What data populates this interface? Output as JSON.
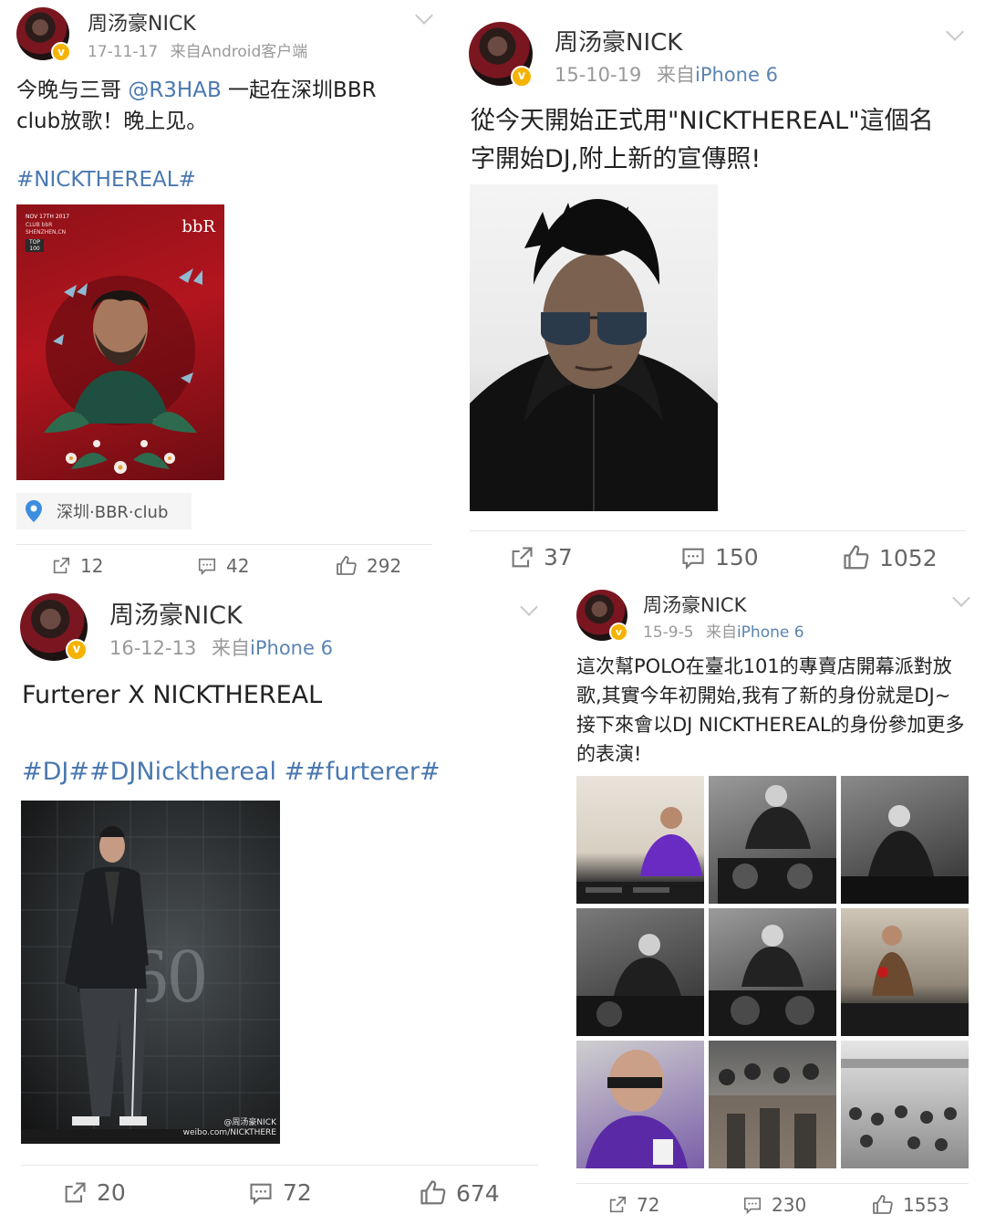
{
  "posts": [
    {
      "user": "周汤豪NICK",
      "date": "17-11-17",
      "source_prefix": "来自",
      "source": "Android客户端",
      "text_before": "今晚与三哥 ",
      "mention": "@R3HAB",
      "text_after": " 一起在深圳BBR club放歌！晚上见。",
      "hashtags": "#NICKTHEREAL#",
      "location": "深圳·BBR·club",
      "poster_text": {
        "date": "NOV 17TH 2017",
        "venue": "CLUB bbR",
        "city": "SHENZHEN,CN",
        "logo": "bbR",
        "badge": "TOP 100"
      },
      "counts": {
        "repost": "12",
        "comment": "42",
        "like": "292"
      }
    },
    {
      "user": "周汤豪NICK",
      "date": "15-10-19",
      "source_prefix": "来自",
      "source": "iPhone 6",
      "text": "從今天開始正式用\"NICKTHEREAL\"這個名字開始DJ,附上新的宣傳照!",
      "counts": {
        "repost": "37",
        "comment": "150",
        "like": "1052"
      }
    },
    {
      "user": "周汤豪NICK",
      "date": "16-12-13",
      "source_prefix": "来自",
      "source": "iPhone 6",
      "text": "Furterer X NICKTHEREAL",
      "hashtags": "#DJ##DJNickthereal ##furterer#",
      "watermark": "@周汤豪NICK weibo.com/NICKTHERE",
      "counts": {
        "repost": "20",
        "comment": "72",
        "like": "674"
      }
    },
    {
      "user": "周汤豪NICK",
      "date": "15-9-5",
      "source_prefix": "来自",
      "source": "iPhone 6",
      "text": "這次幫POLO在臺北101的專賣店開幕派對放歌,其實今年初開始,我有了新的身份就是DJ~接下來會以DJ NICKTHEREAL的身份參加更多的表演!",
      "counts": {
        "repost": "72",
        "comment": "230",
        "like": "1553"
      }
    }
  ],
  "colors": {
    "link": "#4a78b0",
    "badge": "#f5b300",
    "meta": "#999999"
  },
  "icons": {
    "repost": "repost-icon",
    "comment": "comment-icon",
    "like": "thumbs-up-icon",
    "verified": "verified-badge-icon",
    "location": "location-pin-icon",
    "more": "chevron-down-icon"
  }
}
